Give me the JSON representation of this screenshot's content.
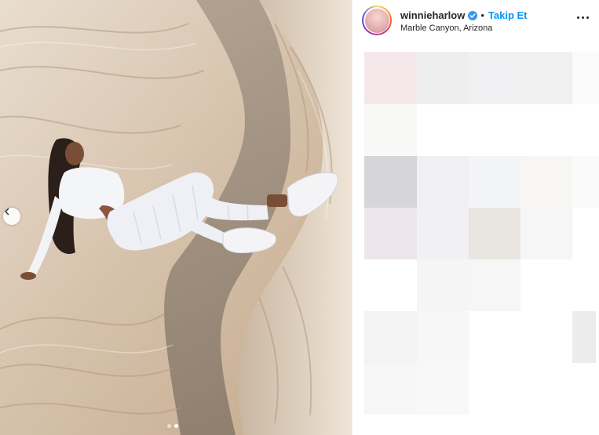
{
  "post": {
    "author": {
      "username": "winnieharlow",
      "verified": true,
      "separator": "•",
      "follow_label": "Takip Et",
      "location": "Marble Canyon, Arizona"
    },
    "media": {
      "alt": "photo",
      "carousel_count": 2,
      "carousel_active_index": 2
    }
  },
  "colors": {
    "follow_blue": "#0095f6",
    "verified_blue": "#3897f0",
    "text_primary": "#262626"
  },
  "icons": {
    "prev": "chevron-left-icon",
    "verified": "verified-badge-icon",
    "more": "more-options-icon"
  }
}
